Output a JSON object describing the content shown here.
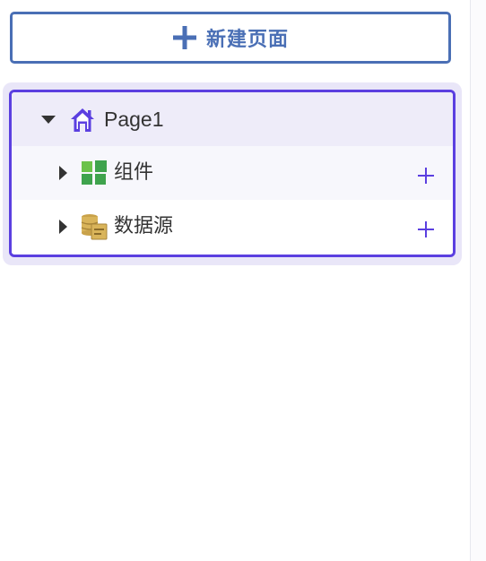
{
  "toolbar": {
    "new_page_label": "新建页面"
  },
  "tree": {
    "page": {
      "label": "Page1",
      "icon": "home-icon",
      "expanded": true
    },
    "children": [
      {
        "label": "组件",
        "icon": "components-grid-icon",
        "expanded": false
      },
      {
        "label": "数据源",
        "icon": "datasource-icon",
        "expanded": false
      }
    ]
  },
  "colors": {
    "accent_blue": "#4a6fb5",
    "accent_purple": "#5b3fe0",
    "component_green": "#5cb85c",
    "datasource_gold": "#d9b45a"
  }
}
